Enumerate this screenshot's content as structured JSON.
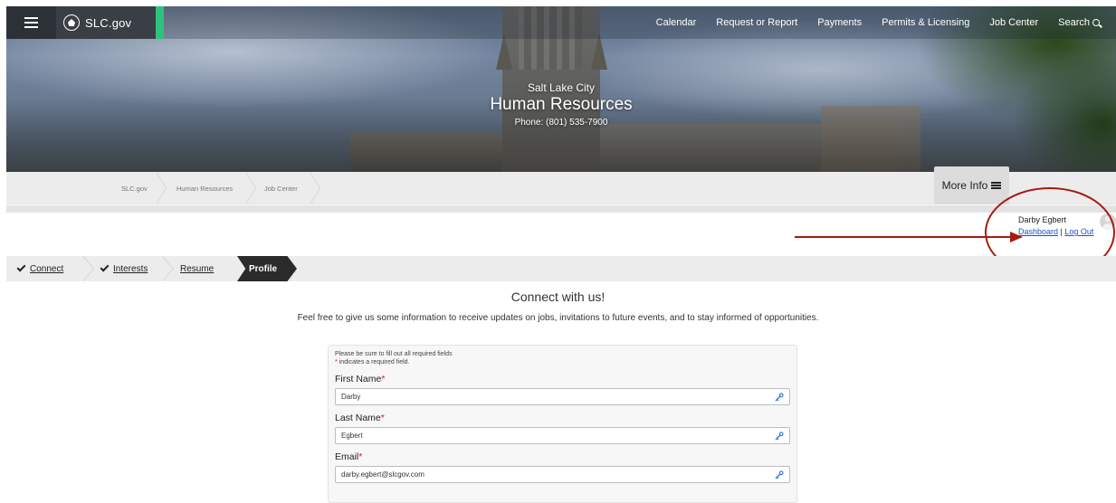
{
  "header": {
    "brand": "SLC.gov",
    "nav": [
      "Calendar",
      "Request or Report",
      "Payments",
      "Permits & Licensing",
      "Job Center"
    ],
    "search_label": "Search",
    "colors": {
      "accent": "#2ec27e",
      "dark": "#2c3138"
    }
  },
  "hero": {
    "subtitle": "Salt Lake City",
    "title": "Human Resources",
    "phone": "Phone: (801) 535-7900"
  },
  "breadcrumb": {
    "items": [
      "SLC.gov",
      "Human Resources",
      "Job Center"
    ],
    "more_info": "More Info"
  },
  "user": {
    "name": "Darby Egbert",
    "dashboard": "Dashboard",
    "separator": "|",
    "logout": "Log Out"
  },
  "steps": {
    "items": [
      "Connect",
      "Interests",
      "Resume",
      "Profile"
    ],
    "active": "Profile"
  },
  "connect": {
    "title": "Connect with us!",
    "description": "Feel free to give us some information to receive updates on jobs, invitations to future events, and to stay informed of opportunities."
  },
  "form": {
    "note": "Please be sure to fill out all required fields",
    "required_note": "indicates a required field.",
    "required_mark": "*",
    "fields": [
      {
        "label": "First Name",
        "value": "Darby"
      },
      {
        "label": "Last Name",
        "value": "Egbert"
      },
      {
        "label": "Email",
        "value": "darby.egbert@slcgov.com"
      }
    ]
  }
}
